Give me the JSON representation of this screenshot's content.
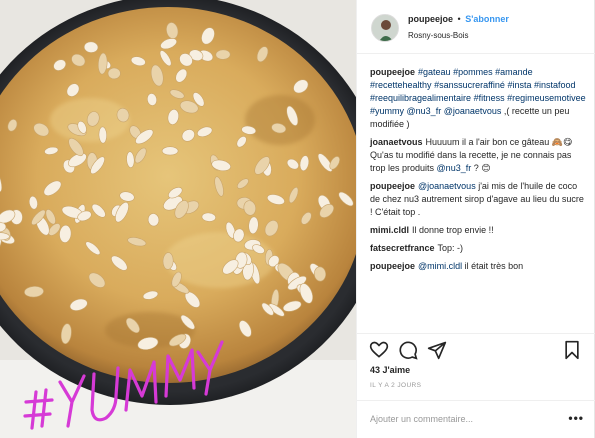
{
  "header": {
    "username": "poupeejoe",
    "separator": "•",
    "follow_label": "S'abonner",
    "location": "Rosny-sous-Bois"
  },
  "photo": {
    "overlay_text": "#YUMMY",
    "overlay_color": "#d63ad6"
  },
  "comments": [
    {
      "user": "poupeejoe",
      "parts": [
        {
          "t": "tag",
          "v": "#gateau"
        },
        {
          "t": "txt",
          "v": " "
        },
        {
          "t": "tag",
          "v": "#pommes"
        },
        {
          "t": "txt",
          "v": " "
        },
        {
          "t": "tag",
          "v": "#amande"
        },
        {
          "t": "txt",
          "v": " "
        },
        {
          "t": "tag",
          "v": "#recettehealthy"
        },
        {
          "t": "txt",
          "v": " "
        },
        {
          "t": "tag",
          "v": "#sanssucreraffiné"
        },
        {
          "t": "txt",
          "v": " "
        },
        {
          "t": "tag",
          "v": "#insta"
        },
        {
          "t": "txt",
          "v": " "
        },
        {
          "t": "tag",
          "v": "#instafood"
        },
        {
          "t": "txt",
          "v": " "
        },
        {
          "t": "tag",
          "v": "#reequilibragealimentaire"
        },
        {
          "t": "txt",
          "v": " "
        },
        {
          "t": "tag",
          "v": "#fitness"
        },
        {
          "t": "txt",
          "v": " "
        },
        {
          "t": "tag",
          "v": "#regimeusemotivee"
        },
        {
          "t": "txt",
          "v": " "
        },
        {
          "t": "tag",
          "v": "#yummy"
        },
        {
          "t": "txt",
          "v": " "
        },
        {
          "t": "tag",
          "v": "@nu3_fr"
        },
        {
          "t": "txt",
          "v": " "
        },
        {
          "t": "tag",
          "v": "@joanaetvous"
        },
        {
          "t": "txt",
          "v": " ,( recette un peu modifiée )"
        }
      ]
    },
    {
      "user": "joanaetvous",
      "parts": [
        {
          "t": "txt",
          "v": "Huuuum il a l'air bon ce gâteau 🙈😋 Qu'as tu modifié dans la recette, je ne connais pas trop les produits "
        },
        {
          "t": "tag",
          "v": "@nu3_fr"
        },
        {
          "t": "txt",
          "v": " ? 😊"
        }
      ]
    },
    {
      "user": "poupeejoe",
      "parts": [
        {
          "t": "tag",
          "v": "@joanaetvous"
        },
        {
          "t": "txt",
          "v": " j'ai mis de l'huile de coco de chez nu3 autrement sirop d'agave au lieu du sucre ! C'était top ."
        }
      ]
    },
    {
      "user": "mimi.cldl",
      "parts": [
        {
          "t": "txt",
          "v": "Il donne trop envie !!"
        }
      ]
    },
    {
      "user": "fatsecretfrance",
      "parts": [
        {
          "t": "txt",
          "v": "Top: -)"
        }
      ]
    },
    {
      "user": "poupeejoe",
      "parts": [
        {
          "t": "tag",
          "v": "@mimi.cldl"
        },
        {
          "t": "txt",
          "v": " il était très bon"
        }
      ]
    }
  ],
  "actions": {
    "like_icon": "heart-icon",
    "comment_icon": "comment-icon",
    "share_icon": "share-icon",
    "save_icon": "bookmark-icon"
  },
  "likes_label": "43 J'aime",
  "date_label": "IL Y A 2 JOURS",
  "add_comment": {
    "placeholder": "Ajouter un commentaire...",
    "more": "•••"
  },
  "colors": {
    "link": "#3897f0",
    "tag": "#003569",
    "text": "#262626",
    "muted": "#999999",
    "border": "#efefef"
  }
}
